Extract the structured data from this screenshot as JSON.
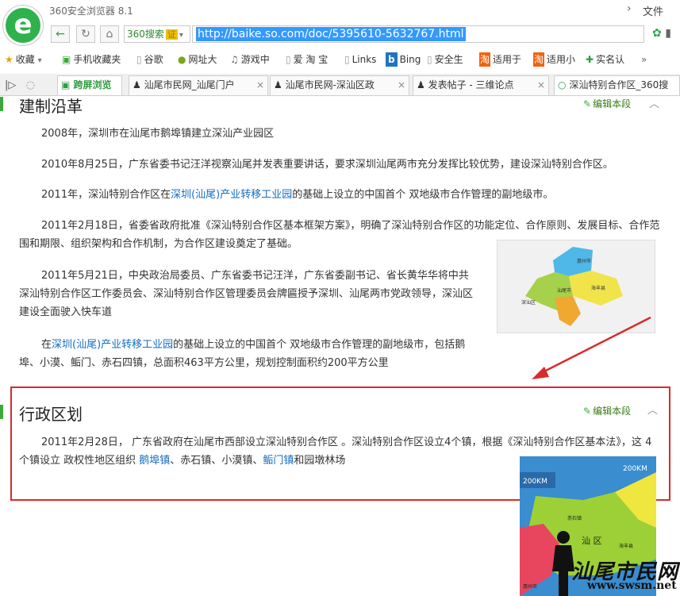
{
  "browser": {
    "title": "360安全浏览器 8.1",
    "file_menu": "文件",
    "search_engine": "360搜索",
    "cert": "证",
    "url": "http://baike.so.com/doc/5395610-5632767.html"
  },
  "bookmarks": [
    {
      "icon": "★",
      "label": "收藏"
    },
    {
      "icon": "▣",
      "label": "手机收藏夹"
    },
    {
      "icon": "▯",
      "label": "谷歌"
    },
    {
      "icon": "●",
      "label": "网址大"
    },
    {
      "icon": "♫",
      "label": "游戏中"
    },
    {
      "icon": "▯",
      "label": "爱 淘 宝"
    },
    {
      "icon": "▯",
      "label": "Links"
    },
    {
      "icon": "b",
      "label": "Bing"
    },
    {
      "icon": "▯",
      "label": "安全生"
    },
    {
      "icon": "淘",
      "label": "适用于"
    },
    {
      "icon": "淘",
      "label": "适用小"
    },
    {
      "icon": "✚",
      "label": "实名认"
    },
    {
      "icon": "»",
      "label": ""
    }
  ],
  "tabs": {
    "cross_screen": "跨屏浏览",
    "items": [
      {
        "label": "汕尾市民网_汕尾门户"
      },
      {
        "label": "汕尾市民网-深汕区政"
      },
      {
        "label": "发表帖子 - 三维论点"
      },
      {
        "label": "深汕特别合作区_360搜"
      }
    ]
  },
  "section1": {
    "title": "建制沿革",
    "edit": "编辑本段",
    "paragraphs": [
      {
        "text": "2008年，深圳市在汕尾市鹅埠镇建立深汕产业园区"
      },
      {
        "text": "2010年8月25日，广东省委书记汪洋视察汕尾并发表重要讲话，要求深圳汕尾两市充分发挥比较优势，建设深汕特别合作区。"
      },
      {
        "pre": "2011年，深汕特别合作区在",
        "link": "深圳(汕尾)产业转移工业园",
        "post": "的基础上设立的中国首个 双地级市合作管理的副地级市。"
      },
      {
        "text": "2011年2月18日，省委省政府批准《深汕特别合作区基本框架方案》，明确了深汕特别合作区的功能定位、合作原则、发展目标、合作范围和期限、组织架构和合作机制，为合作区建设奠定了基础。"
      },
      {
        "text": "2011年5月21日，中央政治局委员、广东省委书记汪洋，广东省委副书记、省长黄华华将中共深汕特别合作区工作委员会、深汕特别合作区管理委员会牌匾授予深圳、汕尾两市党政领导，深汕区建设全面驶入快车道"
      },
      {
        "pre": "在",
        "link": "深圳(汕尾)产业转移工业园",
        "post": "的基础上设立的中国首个 双地级市合作管理的副地级市，包括鹅埠、小漠、鲘门、赤石四镇，总面积463平方公里，规划控制面积约200平方公里"
      }
    ]
  },
  "section2": {
    "title": "行政区划",
    "edit": "编辑本段",
    "pre": "2011年2月28日， 广东省政府在汕尾市西部设立深汕特别合作区 。深汕特别合作区设立4个镇，根据《深汕特别合作区基本法》，这 4个镇设立 政权性地区组织 ",
    "links": [
      "鹅埠镇",
      "赤石镇",
      "小漠镇",
      "鲘门镇"
    ],
    "sep1": "、",
    "sep2": "、",
    "sep3": "、",
    "post": "和园墩林场"
  },
  "map1": {
    "labels": [
      "惠州市",
      "海丰县",
      "汕尾市",
      "深汕区"
    ]
  },
  "map2": {
    "labels": [
      "200KM",
      "200KM",
      "汕  区",
      "赤石镇",
      "海丰县",
      "惠州市"
    ]
  },
  "watermark": {
    "text": "汕尾市民网",
    "url": "www.swsm.net"
  },
  "colors": {
    "accent_green": "#3bab37",
    "link_blue": "#136ec2",
    "red_box": "#d82b2b",
    "url_highlight": "#3399ff"
  }
}
